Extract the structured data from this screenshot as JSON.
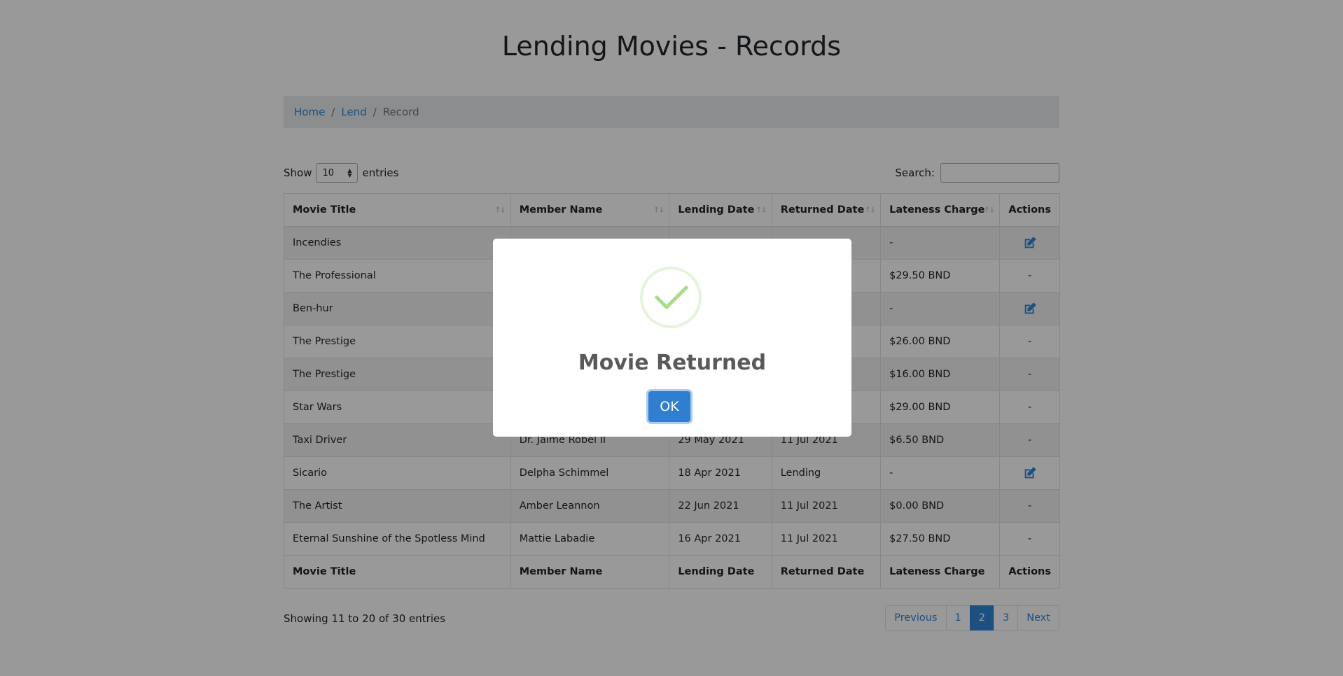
{
  "page": {
    "title": "Lending Movies - Records"
  },
  "breadcrumb": {
    "home": "Home",
    "lend": "Lend",
    "current": "Record",
    "separator": "/"
  },
  "controls": {
    "show_label": "Show",
    "entries_value": "10",
    "entries_label": "entries",
    "search_label": "Search:",
    "search_value": ""
  },
  "table": {
    "headers": [
      "Movie Title",
      "Member Name",
      "Lending Date",
      "Returned Date",
      "Lateness Charge",
      "Actions"
    ],
    "rows": [
      {
        "title": "Incendies",
        "member": "",
        "lend_date": "",
        "return_date": "",
        "charge": "-",
        "action": "edit"
      },
      {
        "title": "The Professional",
        "member": "",
        "lend_date": "",
        "return_date": "",
        "charge": "$29.50 BND",
        "action": "-"
      },
      {
        "title": "Ben-hur",
        "member": "",
        "lend_date": "",
        "return_date": "",
        "charge": "-",
        "action": "edit"
      },
      {
        "title": "The Prestige",
        "member": "",
        "lend_date": "",
        "return_date": "",
        "charge": "$26.00 BND",
        "action": "-"
      },
      {
        "title": "The Prestige",
        "member": "",
        "lend_date": "",
        "return_date": "",
        "charge": "$16.00 BND",
        "action": "-"
      },
      {
        "title": "Star Wars",
        "member": "",
        "lend_date": "",
        "return_date": "",
        "charge": "$29.00 BND",
        "action": "-"
      },
      {
        "title": "Taxi Driver",
        "member": "Dr. Jaime Robel II",
        "lend_date": "29 May 2021",
        "return_date": "11 Jul 2021",
        "charge": "$6.50 BND",
        "action": "-"
      },
      {
        "title": "Sicario",
        "member": "Delpha Schimmel",
        "lend_date": "18 Apr 2021",
        "return_date": "Lending",
        "charge": "-",
        "action": "edit"
      },
      {
        "title": "The Artist",
        "member": "Amber Leannon",
        "lend_date": "22 Jun 2021",
        "return_date": "11 Jul 2021",
        "charge": "$0.00 BND",
        "action": "-"
      },
      {
        "title": "Eternal Sunshine of the Spotless Mind",
        "member": "Mattie Labadie",
        "lend_date": "16 Apr 2021",
        "return_date": "11 Jul 2021",
        "charge": "$27.50 BND",
        "action": "-"
      }
    ]
  },
  "footer": {
    "showing": "Showing 11 to 20 of 30 entries"
  },
  "pagination": {
    "previous": "Previous",
    "pages": [
      "1",
      "2",
      "3"
    ],
    "active_page": "2",
    "next": "Next"
  },
  "modal": {
    "title": "Movie Returned",
    "ok_label": "OK",
    "icon": "checkmark-icon"
  },
  "colors": {
    "accent": "#2e86d6",
    "success": "#a5dc86",
    "overlay": "rgba(0,0,0,0.4)"
  }
}
